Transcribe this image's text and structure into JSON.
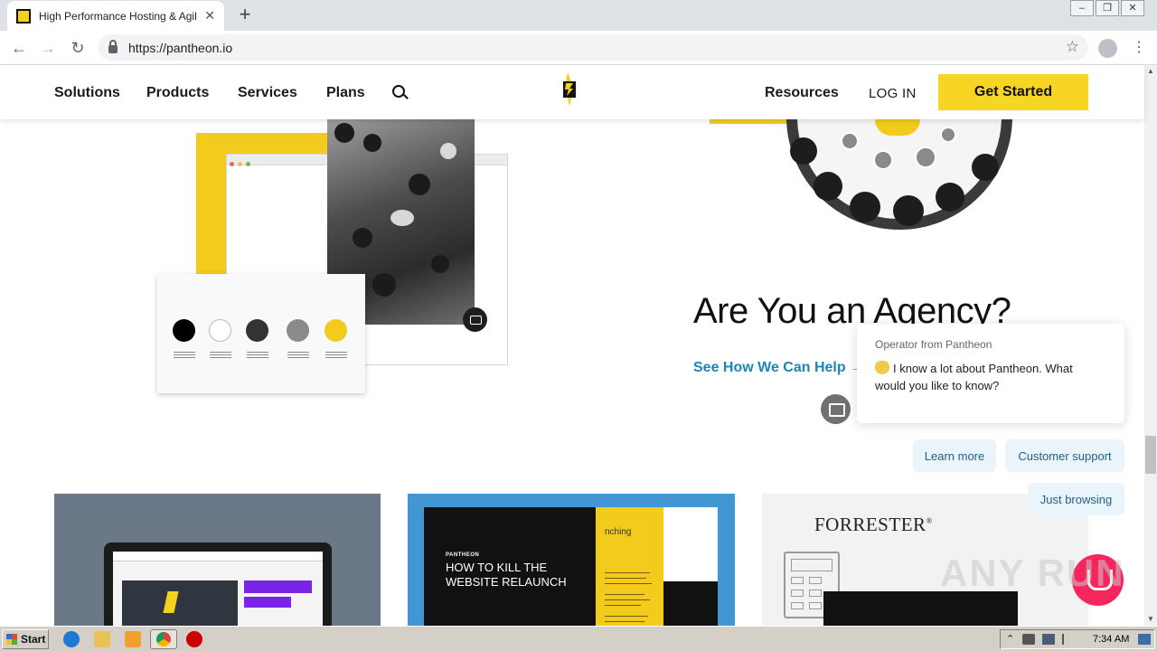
{
  "browser": {
    "tab_title": "High Performance Hosting & Agile W",
    "tab_close": "✕",
    "new_tab": "+",
    "url": "https://pantheon.io",
    "back_glyph": "←",
    "forward_glyph": "→",
    "reload_glyph": "↻",
    "star_glyph": "☆",
    "menu_glyph": "⋮",
    "window_controls": [
      "–",
      "❐",
      "✕"
    ]
  },
  "header": {
    "nav": [
      "Solutions",
      "Products",
      "Services",
      "Plans"
    ],
    "resources": "Resources",
    "login": "LOG IN",
    "cta": "Get Started",
    "accent_color": "#f6d523"
  },
  "hero": {
    "title": "Are You an Agency?",
    "link": "See How We Can Help →",
    "link_color": "#1b86b4",
    "palette_colors": [
      "#000000",
      "#ffffff",
      "#333333",
      "#8a8a8a",
      "#f2cb1c"
    ]
  },
  "cards": {
    "card2_brand": "PANTHEON",
    "card2_heading": "HOW TO KILL THE WEBSITE RELAUNCH",
    "card2_tag": "nching",
    "card3_brand": "FORRESTER",
    "card3_brand_mark": "®"
  },
  "chat": {
    "operator": "Operator from Pantheon",
    "message": "I know a lot about Pantheon. What would you like to know?",
    "options": [
      "Learn more",
      "Customer support",
      "Just browsing"
    ],
    "launcher_color": "#f5265d"
  },
  "watermark": "ANY RUN",
  "taskbar": {
    "start": "Start",
    "clock": "7:34 AM"
  }
}
